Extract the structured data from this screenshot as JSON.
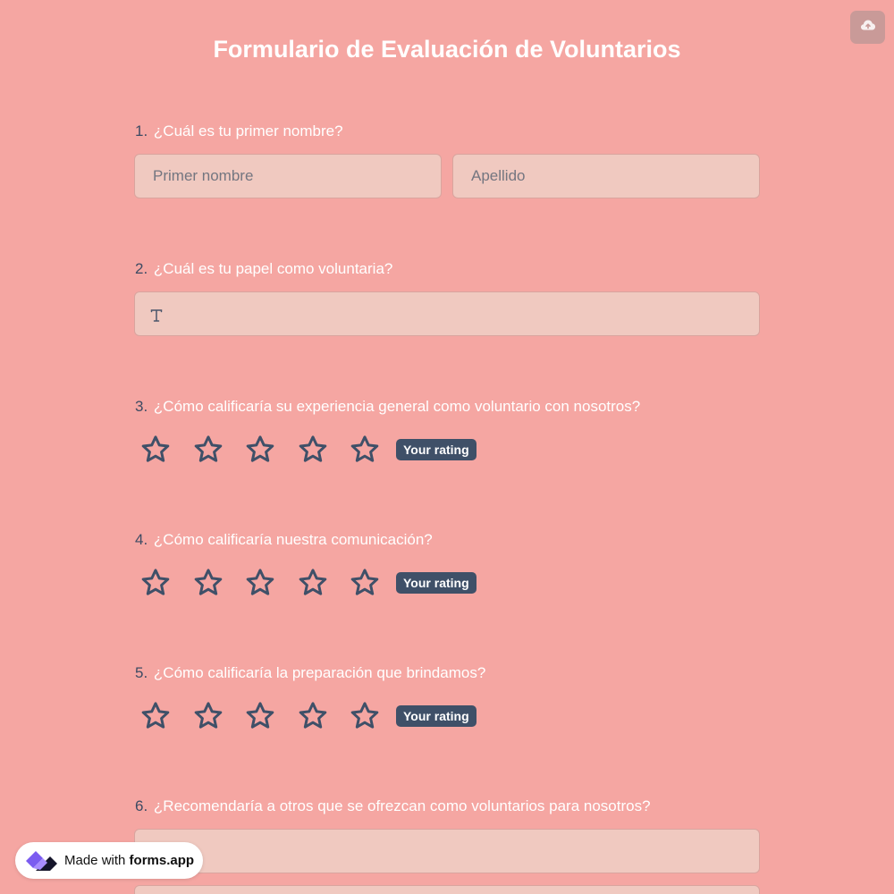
{
  "form": {
    "title": "Formulario de Evaluación de Voluntarios"
  },
  "header": {
    "save_icon": "cloud-upload-icon"
  },
  "questions": [
    {
      "number": "1.",
      "text": "¿Cuál es tu primer nombre?",
      "type": "name",
      "first_name_placeholder": "Primer nombre",
      "last_name_placeholder": "Apellido"
    },
    {
      "number": "2.",
      "text": "¿Cuál es tu papel como voluntaria?",
      "type": "text",
      "value": "",
      "icon": "text-type-icon"
    },
    {
      "number": "3.",
      "text": "¿Cómo calificaría su experiencia general como voluntario con nosotros?",
      "type": "rating",
      "max_stars": 5,
      "selected": 0,
      "badge": "Your rating"
    },
    {
      "number": "4.",
      "text": "¿Cómo calificaría nuestra comunicación?",
      "type": "rating",
      "max_stars": 5,
      "selected": 0,
      "badge": "Your rating"
    },
    {
      "number": "5.",
      "text": "¿Cómo calificaría la preparación que brindamos?",
      "type": "rating",
      "max_stars": 5,
      "selected": 0,
      "badge": "Your rating"
    },
    {
      "number": "6.",
      "text": "¿Recomendaría a otros que se ofrezcan como voluntarios para nosotros?",
      "type": "choice"
    }
  ],
  "footer": {
    "made_with": "Made with",
    "brand": "forms.app",
    "logo_icon": "forms-app-logo-icon"
  },
  "colors": {
    "background": "#f5a6a2",
    "input_background": "#f0c9c0",
    "star_outline": "#3f5068",
    "badge_background": "#3f5068",
    "question_number": "#3d4b63"
  }
}
